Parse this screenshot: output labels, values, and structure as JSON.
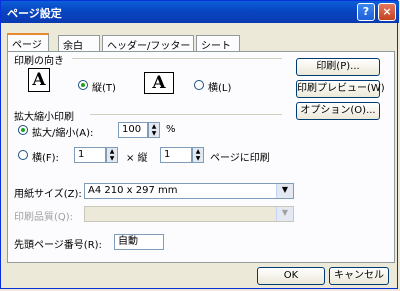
{
  "window": {
    "title": "ページ設定",
    "help_label": "?",
    "close_label": "×"
  },
  "tabs": [
    {
      "label": "ページ"
    },
    {
      "label": "余白"
    },
    {
      "label": "ヘッダー/フッター"
    },
    {
      "label": "シート"
    }
  ],
  "orientation": {
    "group_label": "印刷の向き",
    "portrait_label": "縦(T)",
    "landscape_label": "横(L)",
    "selected": "portrait",
    "paper_glyph": "A"
  },
  "scaling": {
    "group_label": "拡大縮小印刷",
    "zoom_label": "拡大/縮小(A):",
    "zoom_value": "100",
    "zoom_unit": "%",
    "fit_label": "横(F):",
    "fit_wide_value": "1",
    "fit_by_label": "× 縦",
    "fit_tall_value": "1",
    "fit_suffix": "ページに印刷",
    "selected": "zoom"
  },
  "paper": {
    "size_label": "用紙サイズ(Z):",
    "size_value": "A4 210 x 297 mm"
  },
  "quality": {
    "label": "印刷品質(Q):",
    "value": ""
  },
  "first_page": {
    "label": "先頭ページ番号(R):",
    "value": "自動"
  },
  "side_buttons": {
    "print": "印刷(P)...",
    "preview": "印刷プレビュー(W)",
    "options": "オプション(O)..."
  },
  "footer": {
    "ok": "OK",
    "cancel": "キャンセル"
  }
}
